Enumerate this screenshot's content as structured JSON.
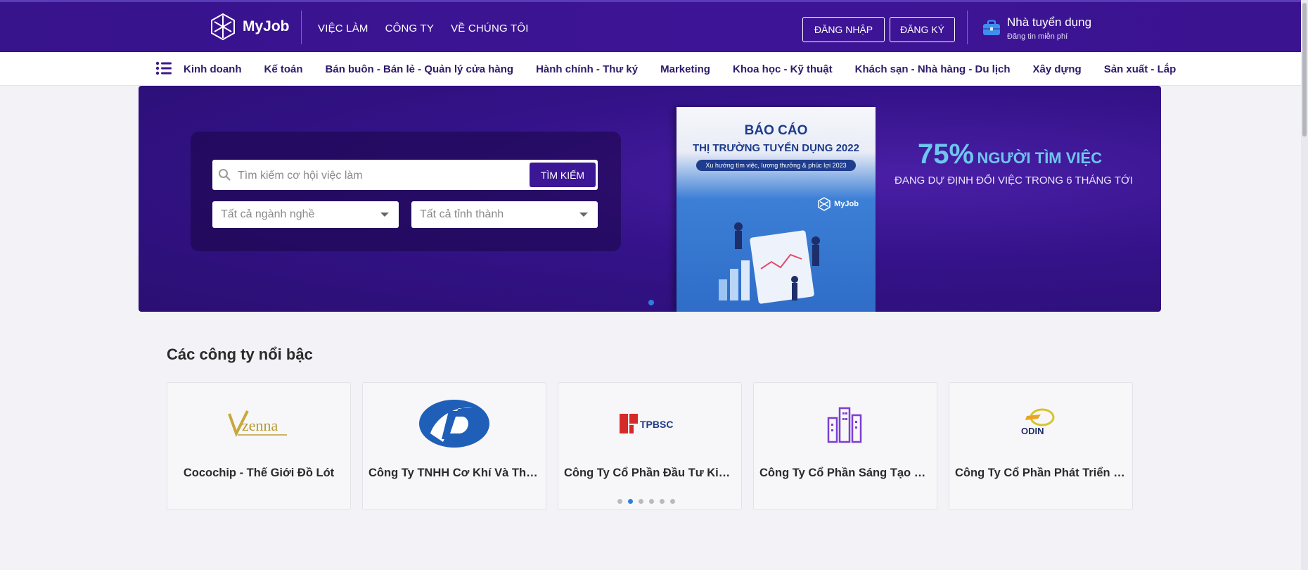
{
  "header": {
    "logo_text": "MyJob",
    "nav": [
      "VIỆC LÀM",
      "CÔNG TY",
      "VỀ CHÚNG TÔI"
    ],
    "login_label": "ĐĂNG NHẬP",
    "register_label": "ĐĂNG KÝ",
    "employer_title": "Nhà tuyển dụng",
    "employer_subtitle": "Đăng tin miễn phí"
  },
  "categories": [
    "Kinh doanh",
    "Kế toán",
    "Bán buôn - Bán lẻ - Quản lý cửa hàng",
    "Hành chính - Thư ký",
    "Marketing",
    "Khoa học - Kỹ thuật",
    "Khách sạn - Nhà hàng - Du lịch",
    "Xây dựng",
    "Sản xuất - Lắp"
  ],
  "search": {
    "placeholder": "Tìm kiếm cơ hội việc làm",
    "button_label": "TÌM KIẾM",
    "industry_select": "Tất cả ngành nghề",
    "province_select": "Tất cả tỉnh thành"
  },
  "banner": {
    "report_title": "BÁO CÁO",
    "report_subtitle": "THỊ TRƯỜNG TUYỂN DỤNG 2022",
    "report_tagline": "Xu hướng tìm việc, lương thưởng & phúc lợi 2023",
    "report_logo": "MyJob",
    "stat_percent": "75%",
    "stat_text": "NGƯỜI TÌM VIỆC",
    "stat_sub": "ĐANG DỰ ĐỊNH ĐỔI VIỆC TRONG 6 THÁNG TỚI"
  },
  "companies": {
    "title": "Các công ty nổi bậc",
    "items": [
      {
        "name": "Cocochip - Thế Giới Đồ Lót",
        "logo_text": "zenna"
      },
      {
        "name": "Công Ty TNHH Cơ Khí Và Thương Mại",
        "logo_text": ""
      },
      {
        "name": "Công Ty Cổ Phần Đầu Tư Kinh Doanh",
        "logo_text": "TPBSC"
      },
      {
        "name": "Công Ty Cổ Phần Sáng Tạo Việt",
        "logo_text": ""
      },
      {
        "name": "Công Ty Cổ Phần Phát Triển Giáo Dục",
        "logo_text": "ODIN"
      }
    ],
    "pager_count": 6,
    "pager_active": 2
  },
  "colors": {
    "brand": "#3b1695",
    "header_bg": "#37138c",
    "accent_blue": "#2d7fe0",
    "stat_cyan": "#6ec6ee"
  }
}
